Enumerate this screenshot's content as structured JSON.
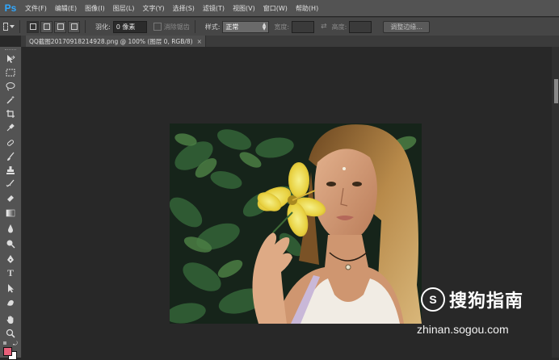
{
  "app": {
    "logo": "Ps"
  },
  "menu": [
    "文件(F)",
    "编辑(E)",
    "图像(I)",
    "图层(L)",
    "文字(Y)",
    "选择(S)",
    "滤镜(T)",
    "视图(V)",
    "窗口(W)",
    "帮助(H)"
  ],
  "options": {
    "feather_label": "羽化:",
    "feather_value": "0 像素",
    "antialias_label": "消除锯齿",
    "style_label": "样式:",
    "style_value": "正常",
    "width_label": "宽度:",
    "height_label": "高度:",
    "refine_edge_button": "调整边缘..."
  },
  "document": {
    "tab_title": "QQ截图20170918214928.png @ 100% (图层 0, RGB/8)",
    "close_glyph": "×"
  },
  "colors": {
    "foreground": "#e8607a",
    "background": "#ffffff",
    "accent": "#31a8ff"
  },
  "watermark": {
    "logo_letter": "S",
    "brand": "搜狗指南",
    "url": "zhinan.sogou.com"
  },
  "icons": [
    "move-tool-icon",
    "rectangular-marquee-icon",
    "lasso-icon",
    "magic-wand-icon",
    "crop-icon",
    "eyedropper-icon",
    "spot-healing-icon",
    "brush-icon",
    "clone-stamp-icon",
    "history-brush-icon",
    "eraser-icon",
    "gradient-icon",
    "blur-icon",
    "dodge-icon",
    "pen-icon",
    "type-icon",
    "path-selection-icon",
    "custom-shape-icon",
    "hand-icon",
    "zoom-icon"
  ]
}
